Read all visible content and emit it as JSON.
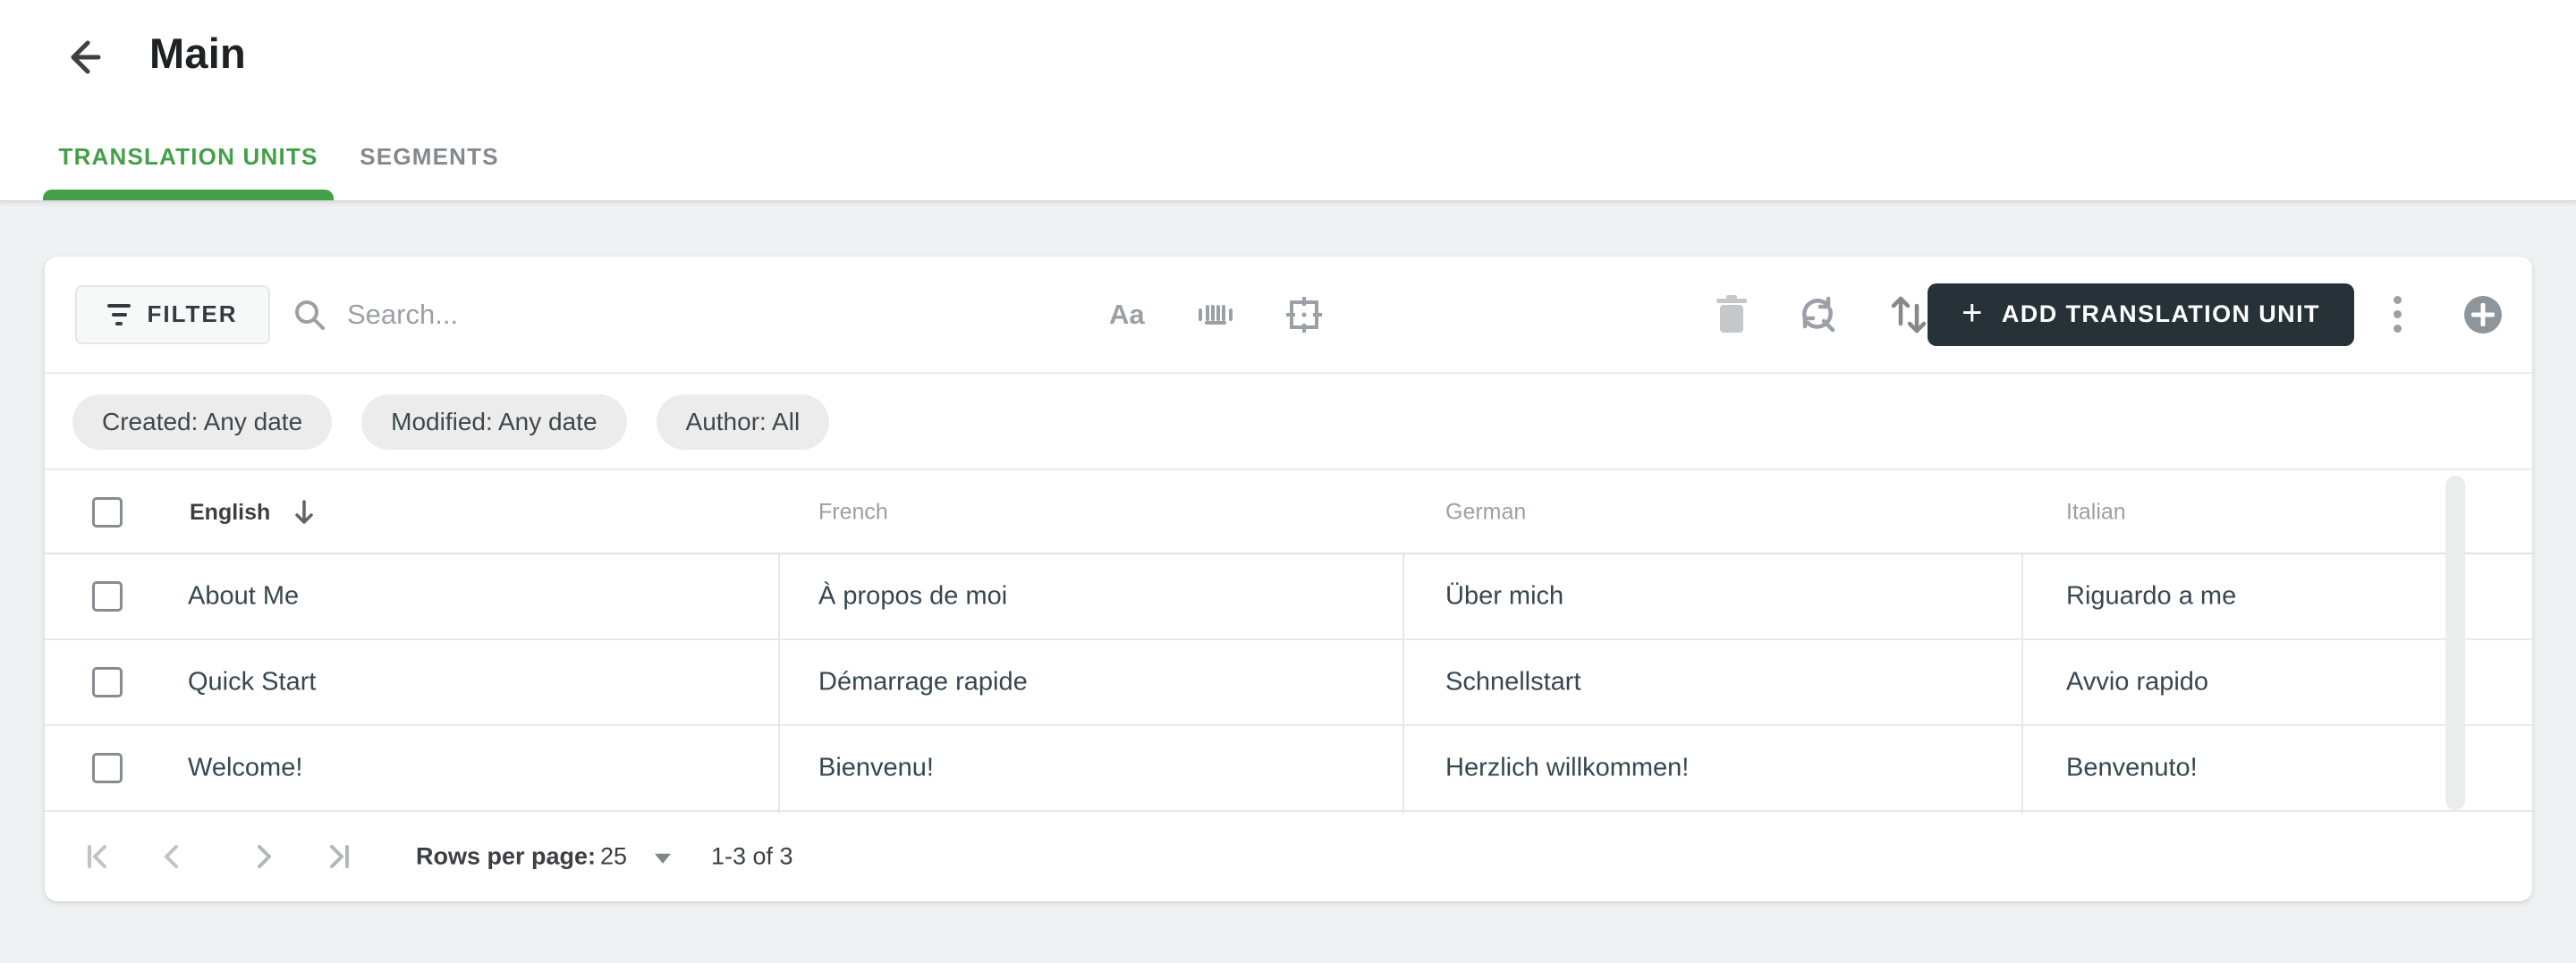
{
  "header": {
    "title": "Main"
  },
  "tabs": [
    {
      "label": "TRANSLATION UNITS",
      "active": true
    },
    {
      "label": "SEGMENTS",
      "active": false
    }
  ],
  "toolbar": {
    "filter_label": "FILTER",
    "search_placeholder": "Search...",
    "match_case_label": "Aa",
    "add_label": "ADD TRANSLATION UNIT",
    "add_plus": "+",
    "icons": [
      "match-case",
      "match-whole-word",
      "regex-selection",
      "delete",
      "find-replace",
      "sort",
      "more-options",
      "add-circle"
    ]
  },
  "chips": [
    {
      "label": "Created: Any date"
    },
    {
      "label": "Modified: Any date"
    },
    {
      "label": "Author: All"
    }
  ],
  "table": {
    "columns": [
      "English",
      "French",
      "German",
      "Italian"
    ],
    "sorted_column": "English",
    "sort_direction": "down",
    "rows": [
      [
        "About Me",
        "À propos de moi",
        "Über mich",
        "Riguardo a me"
      ],
      [
        "Quick Start",
        "Démarrage rapide",
        "Schnellstart",
        "Avvio rapido"
      ],
      [
        "Welcome!",
        "Bienvenu!",
        "Herzlich willkommen!",
        "Benvenuto!"
      ]
    ]
  },
  "pagination": {
    "rows_per_page_label": "Rows per page:",
    "rows_per_page": "25",
    "range": "1-3 of 3"
  },
  "colors": {
    "accent_green": "#43a047",
    "dark_button": "#263238",
    "page_background": "#f0f1f2"
  }
}
